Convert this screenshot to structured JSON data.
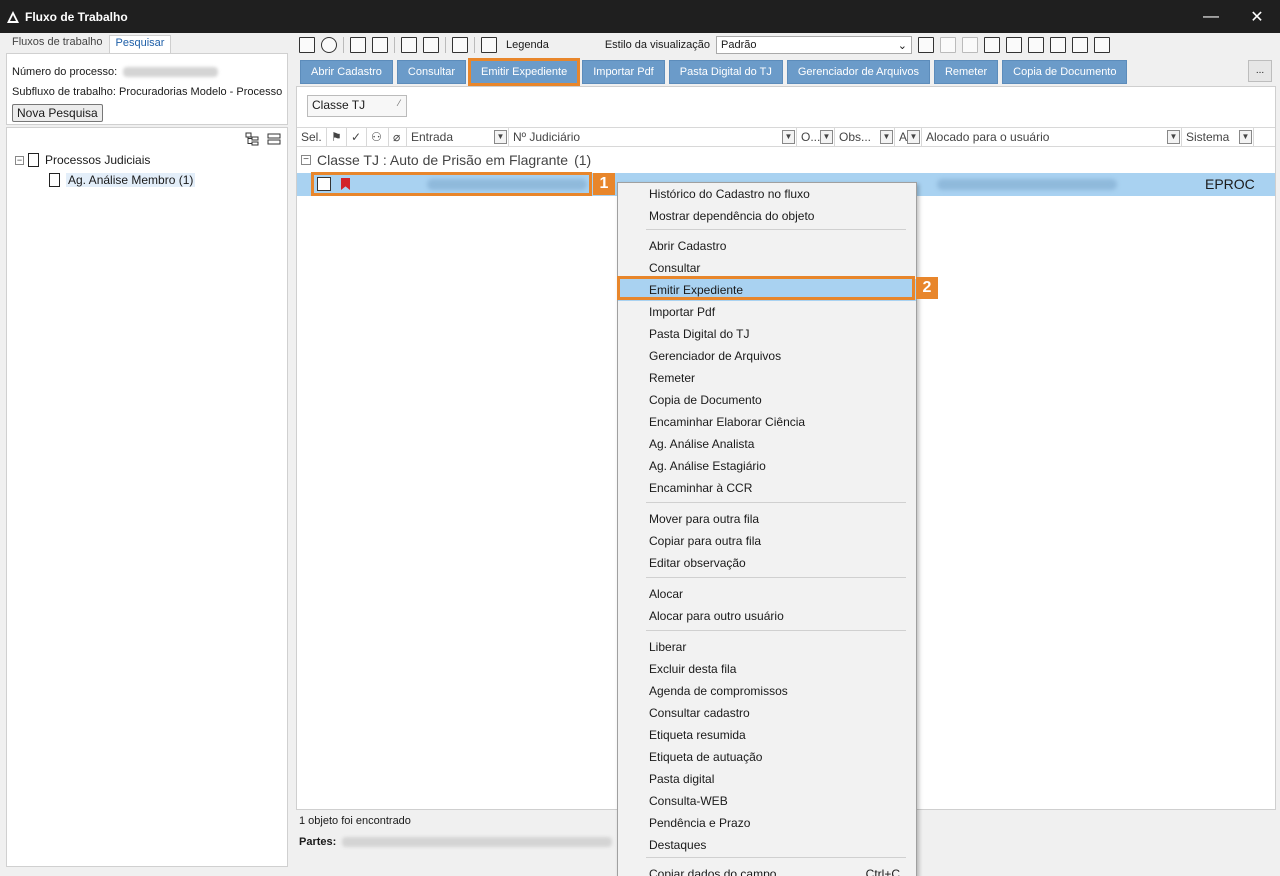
{
  "window": {
    "title": "Fluxo de Trabalho",
    "minimize": "—",
    "close": "✕"
  },
  "left": {
    "tabs": [
      "Fluxos de trabalho",
      "Pesquisar"
    ],
    "numero_label": "Número do processo:",
    "subfluxo_label": "Subfluxo de trabalho: Procuradorias Modelo - Processo",
    "nova_pesquisa": "Nova Pesquisa",
    "tree": {
      "root": "Processos Judiciais",
      "child": "Ag. Análise Membro (1)"
    }
  },
  "toolbar": {
    "legenda": "Legenda",
    "estilo_label": "Estilo da visualização",
    "estilo_value": "Padrão"
  },
  "actions": [
    "Abrir Cadastro",
    "Consultar",
    "Emitir Expediente",
    "Importar Pdf",
    "Pasta Digital do TJ",
    "Gerenciador de Arquivos",
    "Remeter",
    "Copia de Documento"
  ],
  "actions_more": "...",
  "group_button": "Classe TJ",
  "columns": [
    "Sel.",
    "Entrada",
    "Nº Judiciário",
    "O...",
    "Obs...",
    "A",
    "Alocado para o usuário",
    "Sistema"
  ],
  "group": {
    "label": "Classe TJ : Auto de Prisão em Flagrante",
    "count": "(1)"
  },
  "row": {
    "sistema": "EPROC"
  },
  "badges": [
    "1",
    "2"
  ],
  "status": {
    "found": "1 objeto foi encontrado",
    "partes": "Partes:"
  },
  "menu": {
    "g1": [
      "Histórico do Cadastro no fluxo",
      "Mostrar dependência do objeto"
    ],
    "g2": [
      "Abrir Cadastro",
      "Consultar",
      "Emitir Expediente",
      "Importar Pdf",
      "Pasta Digital do TJ",
      "Gerenciador de Arquivos",
      "Remeter",
      "Copia de Documento",
      "Encaminhar Elaborar Ciência",
      "Ag. Análise Analista",
      "Ag. Análise Estagiário",
      "Encaminhar à CCR"
    ],
    "g3": [
      "Mover para outra fila",
      "Copiar para outra fila",
      "Editar observação"
    ],
    "g4": [
      "Alocar",
      "Alocar para outro usuário"
    ],
    "g5": [
      "Liberar",
      "Excluir desta fila",
      "Agenda de compromissos",
      "Consultar cadastro",
      "Etiqueta resumida",
      "Etiqueta de autuação",
      "Pasta digital",
      "Consulta-WEB",
      "Pendência e Prazo",
      "Destaques"
    ],
    "g6": [
      "Copiar dados do campo"
    ],
    "shortcut": "Ctrl+C"
  },
  "colors": {
    "accent_button": "#6b9bc9",
    "highlight_orange": "#e8862b",
    "selection": "#a9d2f1",
    "titlebar": "#1f1f1f"
  }
}
